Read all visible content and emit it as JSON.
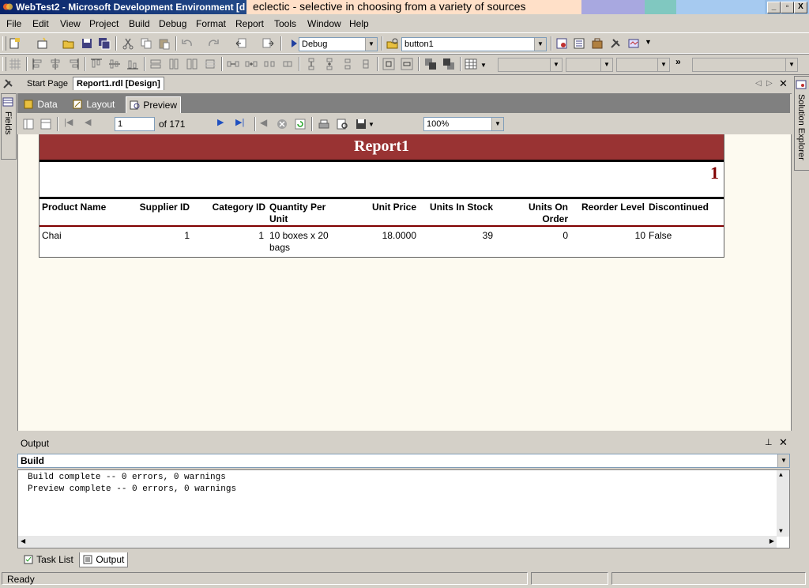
{
  "window": {
    "title": "WebTest2 - Microsoft Development Environment [d",
    "overlay_text": "eclectic - selective in choosing from a variety of sources",
    "buttons": [
      "_",
      "▫",
      "X"
    ]
  },
  "menu": [
    "File",
    "Edit",
    "View",
    "Project",
    "Build",
    "Debug",
    "Format",
    "Report",
    "Tools",
    "Window",
    "Help"
  ],
  "toolbar": {
    "config": "Debug",
    "target": "button1"
  },
  "side": {
    "left_label": "Fields",
    "right_label": "Solution Explorer"
  },
  "doc_tabs": [
    "Start Page",
    "Report1.rdl [Design]"
  ],
  "report_tabs": [
    "Data",
    "Layout",
    "Preview"
  ],
  "preview": {
    "page_current": "1",
    "page_of": "of 171",
    "zoom": "100%"
  },
  "report": {
    "title": "Report1",
    "page_number": "1",
    "columns": [
      "Product Name",
      "Supplier ID",
      "Category ID",
      "Quantity Per Unit",
      "Unit Price",
      "Units In Stock",
      "Units On Order",
      "Reorder Level",
      "Discontinued"
    ],
    "row": {
      "product": "Chai",
      "supplier": "1",
      "category": "1",
      "qpu": "10 boxes x 20 bags",
      "price": "18.0000",
      "stock": "39",
      "order": "0",
      "reorder": "10",
      "discontinued": "False"
    }
  },
  "output": {
    "title": "Output",
    "pane": "Build",
    "lines": [
      "Build complete -- 0 errors, 0 warnings",
      "Preview complete -- 0 errors, 0 warnings"
    ]
  },
  "bottom_tabs": [
    "Task List",
    "Output"
  ],
  "status": "Ready",
  "colors": {
    "report_header": "#993333",
    "accent_red": "#800000",
    "titlebar": "#0a246a"
  }
}
